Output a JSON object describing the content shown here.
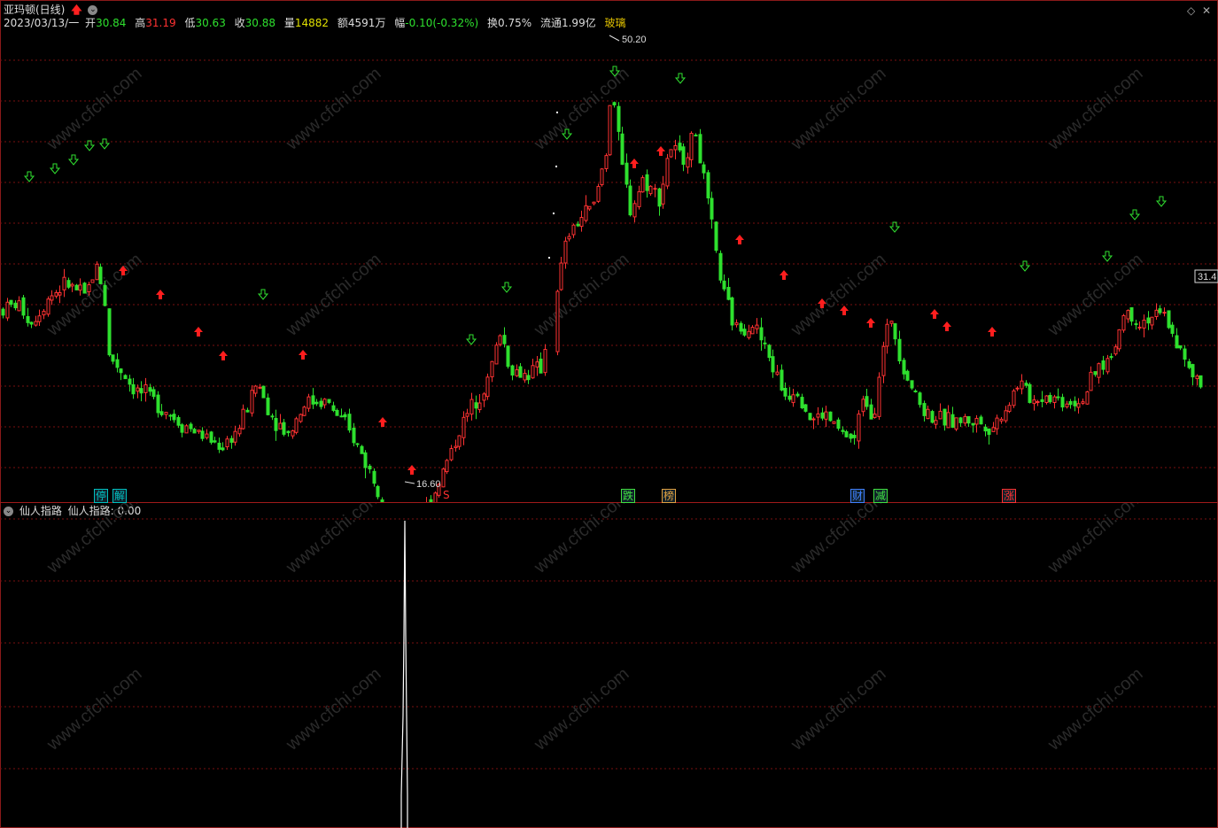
{
  "header": {
    "stock_name": "亚玛顿(日线)",
    "date": "2023/03/13/一",
    "open_label": "开",
    "open": "30.84",
    "high_label": "高",
    "high": "31.19",
    "low_label": "低",
    "low": "30.63",
    "close_label": "收",
    "close": "30.88",
    "volume_label": "量",
    "volume": "14882",
    "amount_label": "额",
    "amount": "4591万",
    "change_label": "幅",
    "change": "-0.10(-0.32%)",
    "turnover_label": "换",
    "turnover": "0.75%",
    "float_label": "流通",
    "float": "1.99亿",
    "concept": "玻璃"
  },
  "price_marks": {
    "high_mark": "50.20",
    "low_mark": "16.60",
    "last_price": "31.4"
  },
  "event_tags": [
    {
      "text": "停",
      "color": "#00c0c0"
    },
    {
      "text": "解",
      "color": "#00c0c0"
    },
    {
      "text": "S",
      "color": "#ff3030"
    },
    {
      "text": "跌",
      "color": "#40e040"
    },
    {
      "text": "榜",
      "color": "#e0a040"
    },
    {
      "text": "财",
      "color": "#4080ff"
    },
    {
      "text": "减",
      "color": "#40e040"
    },
    {
      "text": "涨",
      "color": "#ff3030"
    }
  ],
  "indicator": {
    "panel_title": "仙人指路",
    "value_label": "仙人指路:",
    "value": "0.00"
  },
  "watermark": "www.cfchi.com",
  "colors": {
    "up": "#ff3232",
    "down": "#2ee02e",
    "grid": "#7a1010",
    "border": "#8b1a1a"
  },
  "chart_data": {
    "type": "candlestick",
    "price_high": 50.2,
    "price_low": 16.6,
    "last_close": 30.88,
    "signal_arrows": [
      "buy-up-arrow (red)",
      "sell-down-arrow (green)"
    ]
  }
}
